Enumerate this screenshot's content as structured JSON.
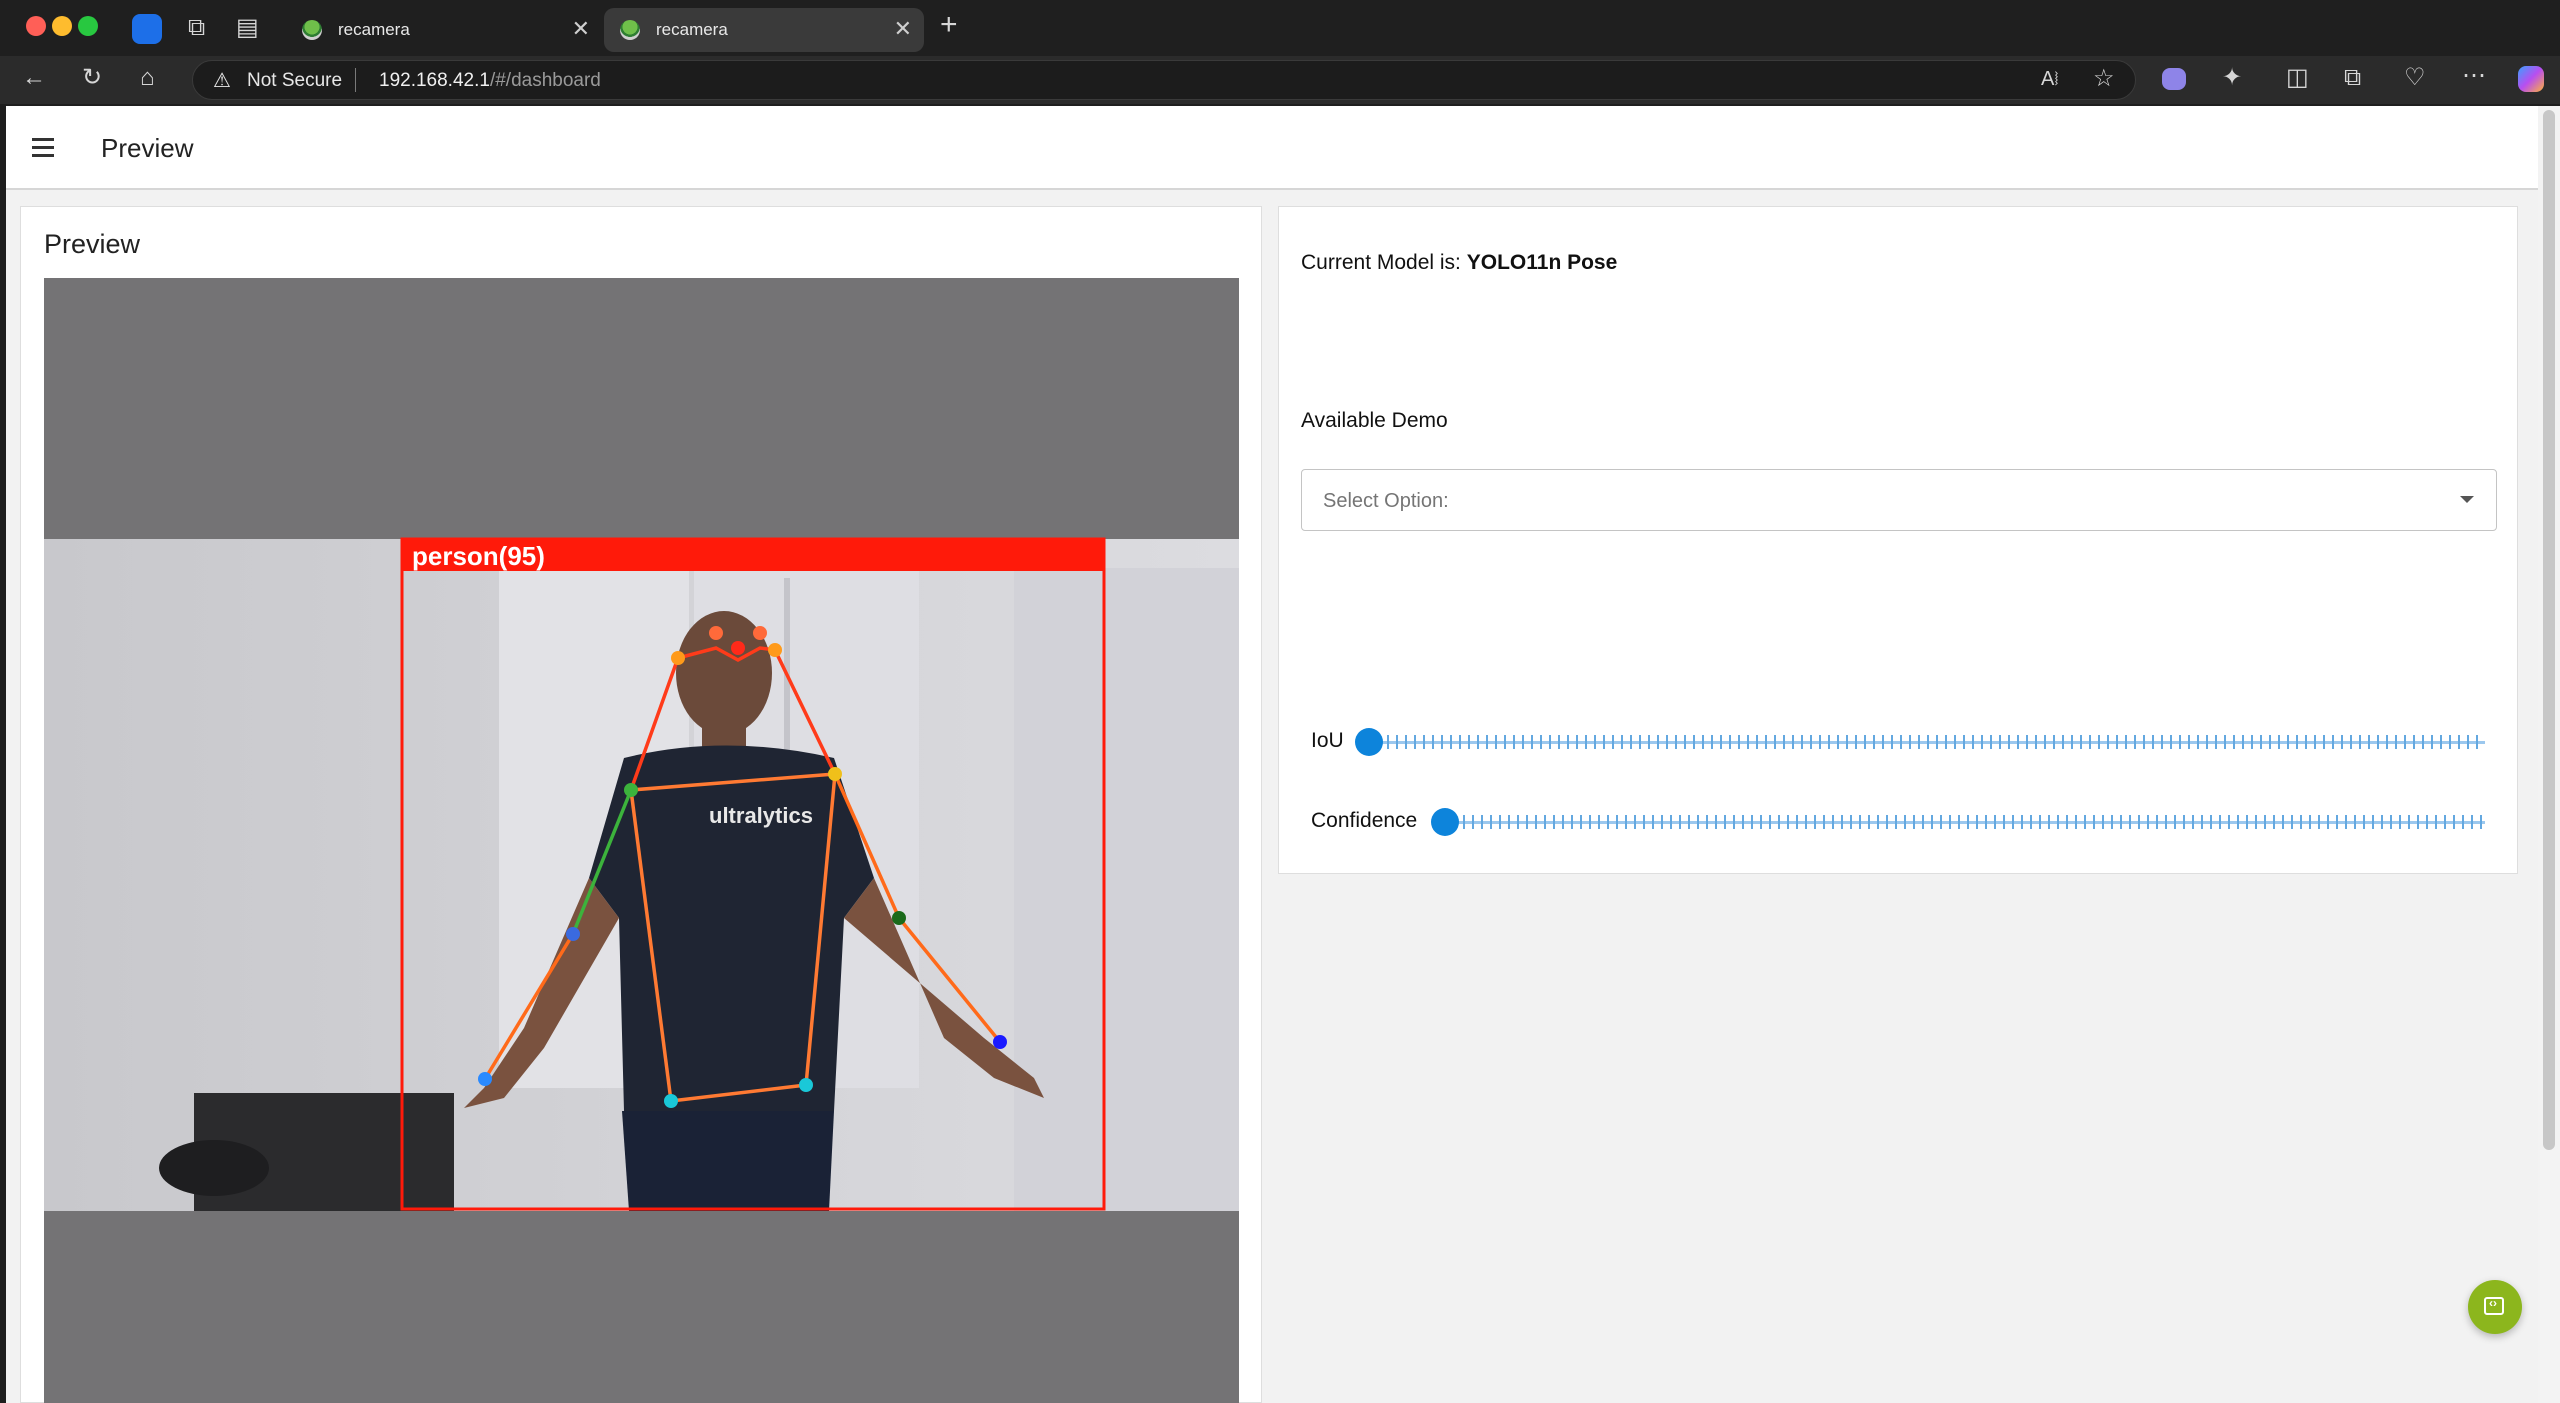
{
  "browser": {
    "tabs": [
      {
        "label": "recamera",
        "active": false
      },
      {
        "label": "recamera",
        "active": true
      }
    ],
    "security_label": "Not Secure",
    "url_host": "192.168.42.1",
    "url_path": "/#/dashboard",
    "new_tab_symbol": "+"
  },
  "app": {
    "title": "Preview"
  },
  "preview": {
    "card_title": "Preview",
    "detection_label": "person(95)"
  },
  "settings": {
    "current_model_label": "Current Model is:",
    "current_model_value": "YOLO11n Pose",
    "available_demo_label": "Available Demo",
    "select_placeholder": "Select Option:",
    "iou_label": "IoU",
    "iou_value": 0,
    "confidence_label": "Confidence",
    "confidence_value": 0
  },
  "colors": {
    "accent": "#0d84db",
    "detection_box": "#ff1a0a",
    "fab": "#8cb61d"
  }
}
